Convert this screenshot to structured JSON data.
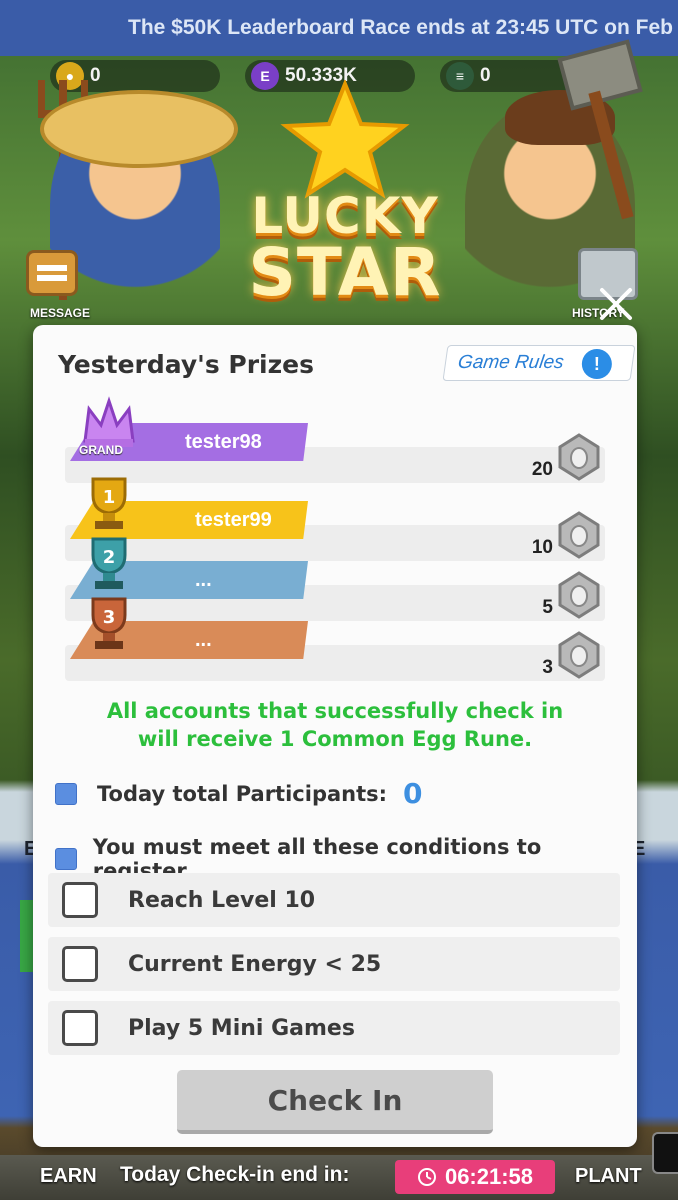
{
  "ticker": {
    "text": "The $50K Leaderboard Race ends at 23:45 UTC on Feb"
  },
  "currencies": [
    {
      "icon": "gold-coin-icon",
      "value": "0",
      "color": "#d9a81b"
    },
    {
      "icon": "e-token-icon",
      "value": "50.333K",
      "color": "#7a3fc7"
    },
    {
      "icon": "stack-token-icon",
      "value": "0",
      "color": "#2e5a3a"
    }
  ],
  "side_labels": {
    "message": "MESSAGE",
    "history": "HISTORY"
  },
  "banner": {
    "line1": "LUCKY",
    "line2": "STAR"
  },
  "modal": {
    "title": "Yesterday's Prizes",
    "rules_label": "Game Rules",
    "rules_icon": "!",
    "prizes": [
      {
        "rank": "grand",
        "tag": "GRAND",
        "name": "tester98",
        "amount": "20",
        "band_color": "#a46ee3"
      },
      {
        "rank": "1",
        "tag": "",
        "name": "tester99",
        "amount": "10",
        "band_color": "#f7c31a"
      },
      {
        "rank": "2",
        "tag": "",
        "name": "...",
        "amount": "5",
        "band_color": "#79aed2"
      },
      {
        "rank": "3",
        "tag": "",
        "name": "...",
        "amount": "3",
        "band_color": "#d98b58"
      }
    ],
    "notice_line1": "All accounts that successfully check in",
    "notice_line2": "will receive 1 Common Egg Rune.",
    "participants_label": "Today total Participants:",
    "participants_count": "0",
    "conditions_label": "You must meet all these conditions to register",
    "conditions": [
      {
        "label": "Reach Level 10",
        "checked": false
      },
      {
        "label": "Current Energy < 25",
        "checked": false
      },
      {
        "label": "Play 5 Mini Games",
        "checked": false
      }
    ],
    "checkin_label": "Check In"
  },
  "bottom": {
    "earn": "EARN",
    "plant": "PLANT",
    "countdown_label": "Today Check-in end in:",
    "countdown_value": "06:21:58"
  },
  "colors": {
    "accent_green": "#2cbf3c",
    "accent_blue": "#3d8fe0",
    "countdown_bg": "#e83e7a"
  }
}
